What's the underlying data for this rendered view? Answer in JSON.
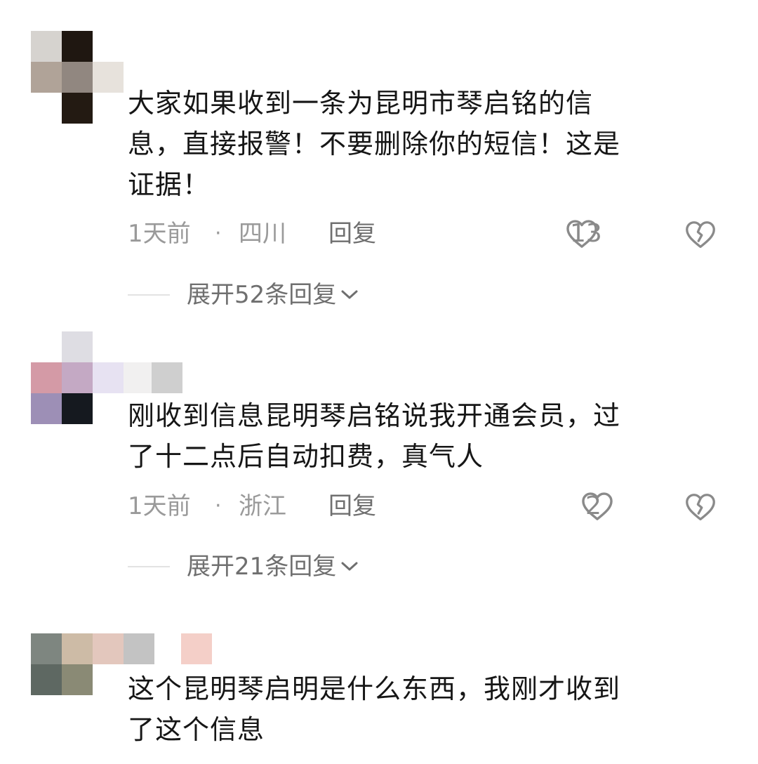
{
  "comments": [
    {
      "text": "大家如果收到一条为昆明市琴启铭的信\n息，直接报警！不要删除你的短信！这是\n证据！",
      "time": "1天前",
      "separator": "·",
      "location": "四川",
      "reply_label": "回复",
      "likes": "13",
      "expand_label": "展开52条回复"
    },
    {
      "text": "刚收到信息昆明琴启铭说我开通会员，过\n了十二点后自动扣费，真气人",
      "time": "1天前",
      "separator": "·",
      "location": "浙江",
      "reply_label": "回复",
      "likes": "2",
      "expand_label": "展开21条回复"
    },
    {
      "text": "这个昆明琴启明是什么东西，我刚才收到\n了这个信息"
    }
  ],
  "icons": {
    "like": "heart-outline-icon",
    "dislike": "broken-heart-icon",
    "expand": "chevron-down-icon"
  },
  "colors": {
    "text": "#161616",
    "meta": "#9a9a9a",
    "reply": "#6f6f6f"
  }
}
